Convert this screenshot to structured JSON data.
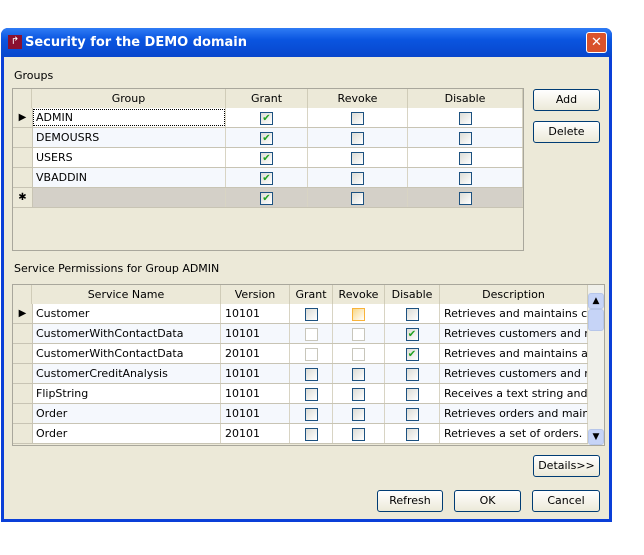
{
  "window": {
    "title": "Security for the DEMO domain",
    "close_glyph": "✕"
  },
  "groups": {
    "label": "Groups",
    "columns": [
      "Group",
      "Grant",
      "Revoke",
      "Disable"
    ],
    "rows": [
      {
        "name": "ADMIN",
        "grant": true,
        "revoke": false,
        "disable": false
      },
      {
        "name": "DEMOUSRS",
        "grant": true,
        "revoke": false,
        "disable": false
      },
      {
        "name": "USERS",
        "grant": true,
        "revoke": false,
        "disable": false
      },
      {
        "name": "VBADDIN",
        "grant": true,
        "revoke": false,
        "disable": false
      }
    ],
    "new_row": {
      "marker": "✱",
      "grant": true,
      "revoke": false,
      "disable": false
    }
  },
  "buttons": {
    "add": "Add",
    "delete": "Delete",
    "details": "Details>>",
    "refresh": "Refresh",
    "ok": "OK",
    "cancel": "Cancel"
  },
  "services": {
    "label": "Service Permissions for Group ADMIN",
    "columns": [
      "Service Name",
      "Version",
      "Grant",
      "Revoke",
      "Disable",
      "Description"
    ],
    "rows": [
      {
        "name": "Customer",
        "version": "10101",
        "grant": false,
        "revoke": false,
        "disable": false,
        "state": "normal",
        "revoke_hot": true,
        "description": "Retrieves and maintains cu"
      },
      {
        "name": "CustomerWithContactData",
        "version": "10101",
        "grant": false,
        "revoke": false,
        "disable": true,
        "state": "disabled",
        "description": "Retrieves customers and m"
      },
      {
        "name": "CustomerWithContactData",
        "version": "20101",
        "grant": false,
        "revoke": false,
        "disable": true,
        "state": "disabled",
        "description": "Retrieves and maintains a"
      },
      {
        "name": "CustomerCreditAnalysis",
        "version": "10101",
        "grant": false,
        "revoke": false,
        "disable": false,
        "state": "normal",
        "description": "Retrieves customers and m"
      },
      {
        "name": "FlipString",
        "version": "10101",
        "grant": false,
        "revoke": false,
        "disable": false,
        "state": "normal",
        "description": "Receives a text string and r"
      },
      {
        "name": "Order",
        "version": "10101",
        "grant": false,
        "revoke": false,
        "disable": false,
        "state": "normal",
        "description": "Retrieves orders and maint"
      },
      {
        "name": "Order",
        "version": "20101",
        "grant": false,
        "revoke": false,
        "disable": false,
        "state": "normal",
        "description": "Retrieves a set of orders."
      }
    ]
  },
  "colors": {
    "titlebar": "#0a55e0",
    "face": "#ECE9D8",
    "check": "#21a121"
  }
}
